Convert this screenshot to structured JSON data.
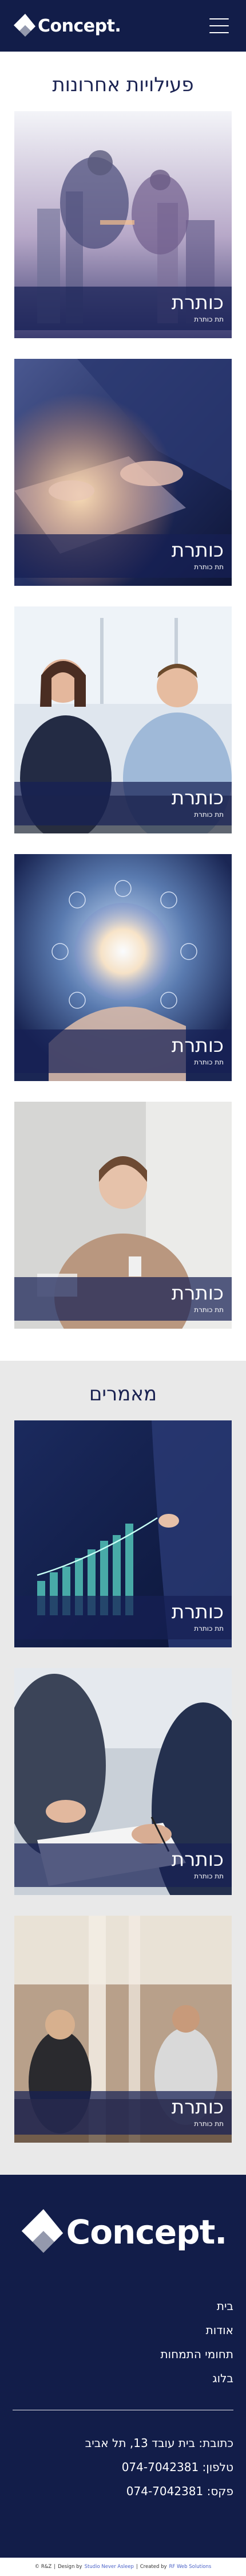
{
  "header": {
    "logo_text": "Concept.",
    "menu_icon": "hamburger-menu-icon"
  },
  "activities": {
    "title": "פעילויות אחרונות",
    "items": [
      {
        "title": "כותרת",
        "subtitle": "תת כותרת",
        "image": "business-people-city-skyline"
      },
      {
        "title": "כותרת",
        "subtitle": "תת כותרת",
        "image": "hands-laptop-glowing-data"
      },
      {
        "title": "כותרת",
        "subtitle": "תת כותרת",
        "image": "business-colleagues-meeting"
      },
      {
        "title": "כותרת",
        "subtitle": "תת כותרת",
        "image": "hand-glowing-globe-icons"
      },
      {
        "title": "כותרת",
        "subtitle": "תת כותרת",
        "image": "woman-listening-at-desk"
      }
    ]
  },
  "articles": {
    "title": "מאמרים",
    "items": [
      {
        "title": "כותרת",
        "subtitle": "תת כותרת",
        "image": "businessman-growth-chart"
      },
      {
        "title": "כותרת",
        "subtitle": "תת כותרת",
        "image": "hands-signing-document"
      },
      {
        "title": "כותרת",
        "subtitle": "תת כותרת",
        "image": "office-team-working"
      }
    ]
  },
  "footer": {
    "logo_text": "Concept.",
    "nav": [
      "בית",
      "אודות",
      "תחומי התמחות",
      "בלוג"
    ],
    "address": "כתובת: בית עובד 13, תל אביב",
    "phone": "טלפון: 074-7042381",
    "fax": "פקס: 074-7042381"
  },
  "copyright": {
    "prefix": "© R&Z",
    "design_label": "Design by",
    "designer": "Studio Never Asleep",
    "created_label": "Created by",
    "creator": "RF Web Solutions"
  },
  "colors": {
    "navy": "#121d49",
    "title": "#1b2352",
    "caption_overlay": "#162054",
    "grey_section": "#e9e9e9"
  }
}
